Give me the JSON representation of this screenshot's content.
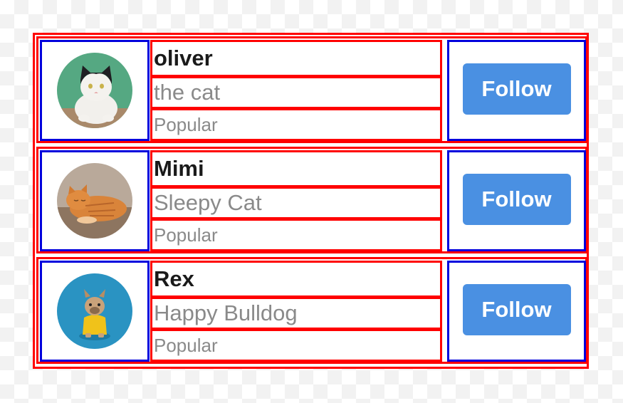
{
  "users": [
    {
      "name": "oliver",
      "description": "the cat",
      "tag": "Popular",
      "follow_label": "Follow",
      "avatar_icon": "cat-photo-avatar"
    },
    {
      "name": "Mimi",
      "description": "Sleepy Cat",
      "tag": "Popular",
      "follow_label": "Follow",
      "avatar_icon": "sleeping-cat-photo-avatar"
    },
    {
      "name": "Rex",
      "description": "Happy Bulldog",
      "tag": "Popular",
      "follow_label": "Follow",
      "avatar_icon": "bulldog-photo-avatar"
    }
  ],
  "colors": {
    "button": "#4a90e2",
    "name_text": "#1a1a1a",
    "secondary_text": "#8a8a8a",
    "outline_red": "#ff0000",
    "outline_blue": "#0000dd"
  }
}
